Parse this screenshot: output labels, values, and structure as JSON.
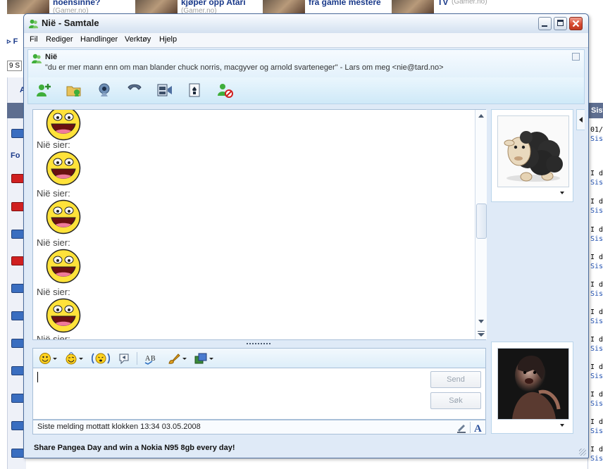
{
  "background": {
    "headlines": [
      {
        "title": "noensinne?",
        "source": "(Gamer.no)"
      },
      {
        "title": "kjøper opp Atari",
        "source": "(Gamer.no)"
      },
      {
        "title": "fra gamle mestere",
        "source": ""
      },
      {
        "title": "TV",
        "source": "(Gamer.no)"
      }
    ],
    "left_labels": {
      "fo": "Fo",
      "nine": "9 S",
      "a": "A",
      "arrow": "▹ F"
    },
    "right_header": "Sist",
    "right_cells": [
      {
        "line1": "01/",
        "line2": "Sist"
      },
      {
        "line1": "I d",
        "line2": "Sist"
      },
      {
        "line1": "I d",
        "line2": "Sist"
      },
      {
        "line1": "I d",
        "line2": "Sist"
      },
      {
        "line1": "I d",
        "line2": "Sist"
      },
      {
        "line1": "I d",
        "line2": "Sist"
      },
      {
        "line1": "I d",
        "line2": "Sist"
      },
      {
        "line1": "I d",
        "line2": "Sist"
      },
      {
        "line1": "I d",
        "line2": "Sist"
      },
      {
        "line1": "I d",
        "line2": "Sist"
      },
      {
        "line1": "I d",
        "line2": "Sist"
      },
      {
        "line1": "I d",
        "line2": "Sist"
      }
    ]
  },
  "window": {
    "title": "Niё - Samtale",
    "menu": [
      "Fil",
      "Rediger",
      "Handlinger",
      "Verktøy",
      "Hjelp"
    ]
  },
  "contact": {
    "name": "Niё",
    "personal_message": "\"du er mer mann enn om man blander chuck norris, macgyver og arnold svarteneger\" - Lars om meg <nie@tard.no>"
  },
  "toolbar_icons": [
    "invite-contact-icon",
    "send-file-icon",
    "webcam-icon",
    "call-icon",
    "video-icon",
    "games-icon",
    "block-contact-icon"
  ],
  "conversation": {
    "messages": [
      {
        "sender": ""
      },
      {
        "sender": "Niё sier:"
      },
      {
        "sender": "Niё sier:"
      },
      {
        "sender": "Niё sier:"
      },
      {
        "sender": "Niё sier:"
      },
      {
        "sender": "Niё sier:"
      }
    ]
  },
  "input": {
    "send_label": "Send",
    "search_label": "Søk",
    "value": ""
  },
  "status_text": "Siste melding mottatt klokken 13:34 03.05.2008",
  "ad_text": "Share Pangea Day and win a Nokia N95 8gb every day!",
  "colors": {
    "accent": "#3a6ec0",
    "window_bg": "#dfeaf7",
    "close_red": "#d84a30"
  }
}
